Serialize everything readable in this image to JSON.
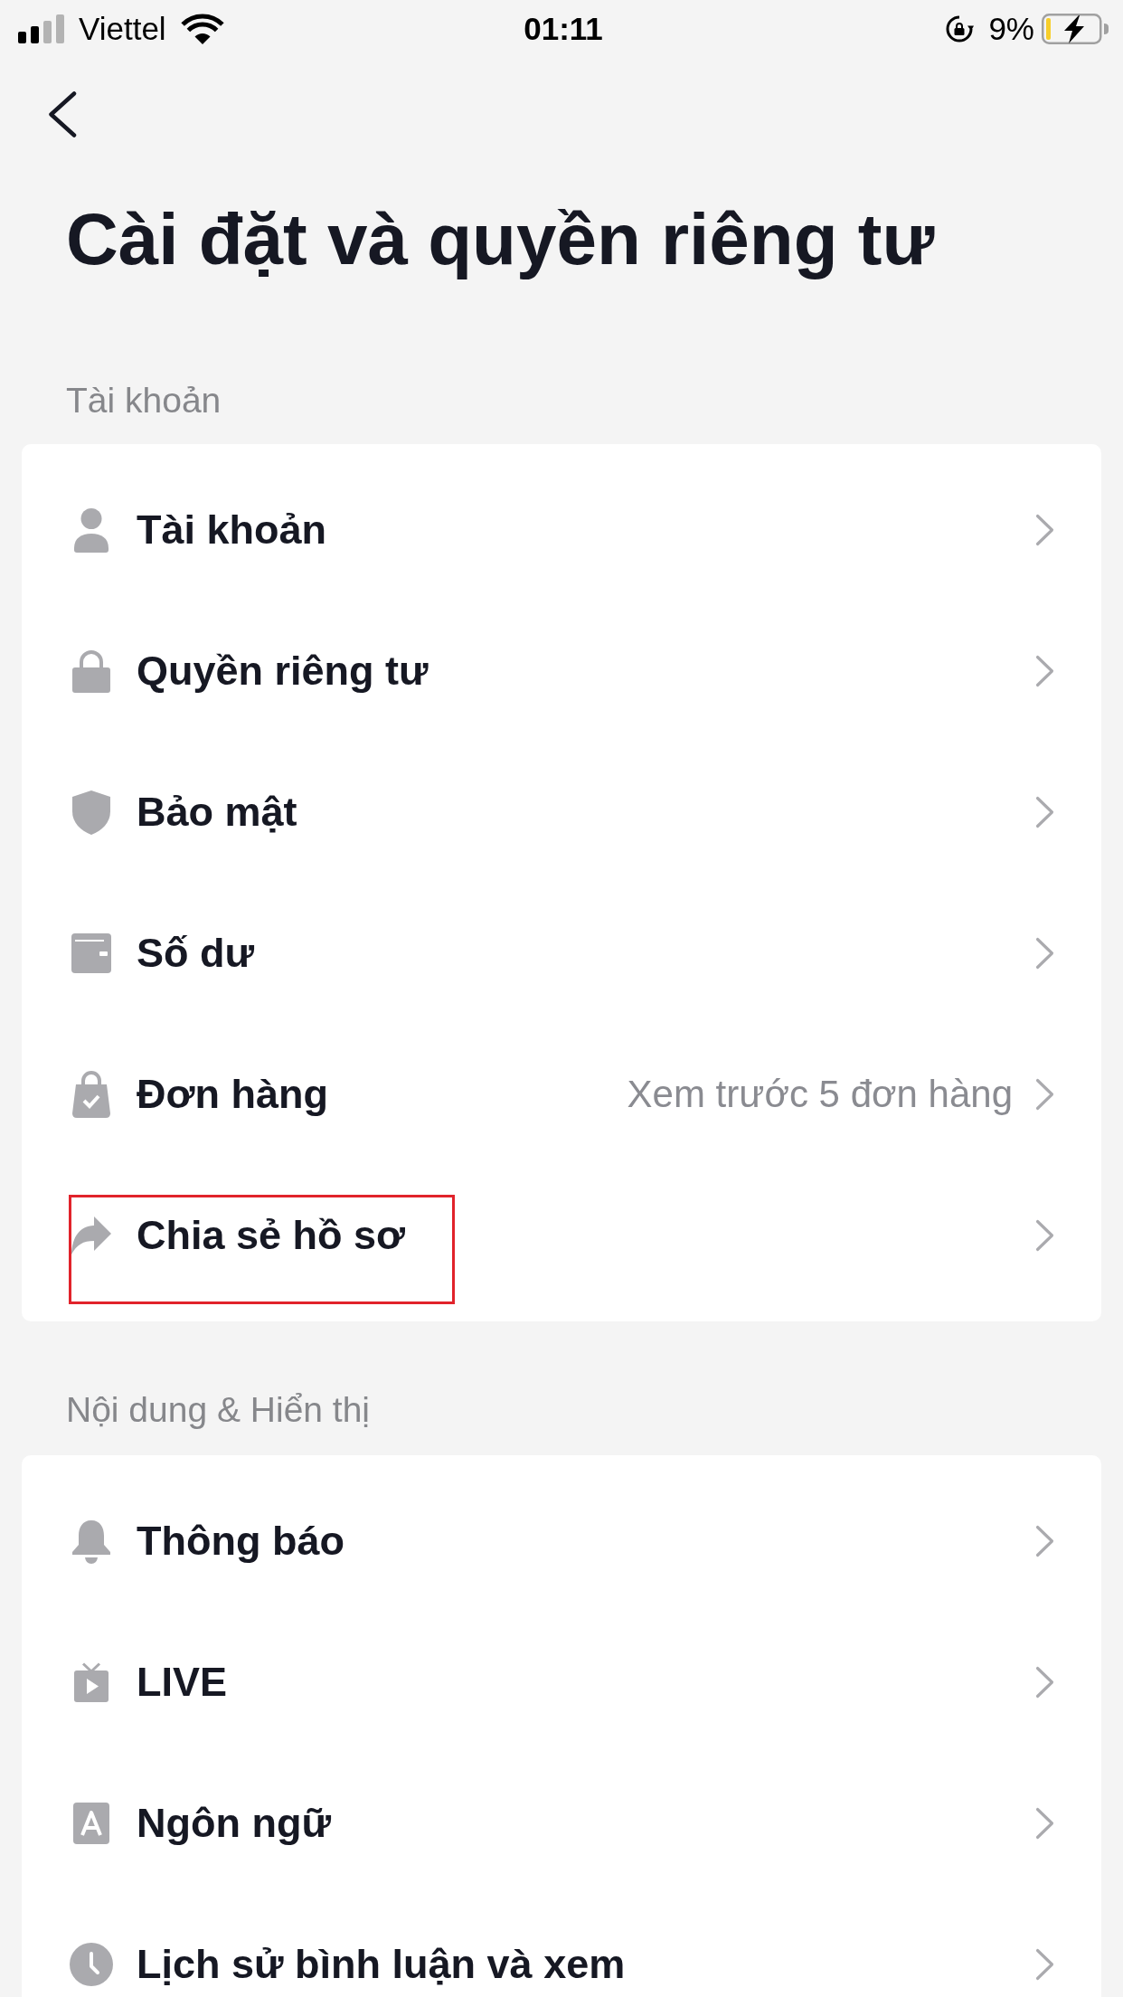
{
  "status_bar": {
    "carrier": "Viettel",
    "time": "01:11",
    "battery_percent": "9%"
  },
  "title": "Cài đặt và quyền riêng tư",
  "sections": [
    {
      "header": "Tài khoản",
      "items": [
        {
          "label": "Tài khoản",
          "highlighted": false
        },
        {
          "label": "Quyền riêng tư",
          "highlighted": false
        },
        {
          "label": "Bảo mật",
          "highlighted": false
        },
        {
          "label": "Số dư",
          "highlighted": false
        },
        {
          "label": "Đơn hàng",
          "value": "Xem trước 5 đơn hàng",
          "highlighted": false
        },
        {
          "label": "Chia sẻ hồ sơ",
          "highlighted": true
        }
      ]
    },
    {
      "header": "Nội dung & Hiển thị",
      "items": [
        {
          "label": "Thông báo",
          "highlighted": false
        },
        {
          "label": "LIVE",
          "highlighted": false
        },
        {
          "label": "Ngôn ngữ",
          "highlighted": false
        },
        {
          "label": "Lịch sử bình luận và xem",
          "highlighted": false
        }
      ]
    }
  ]
}
